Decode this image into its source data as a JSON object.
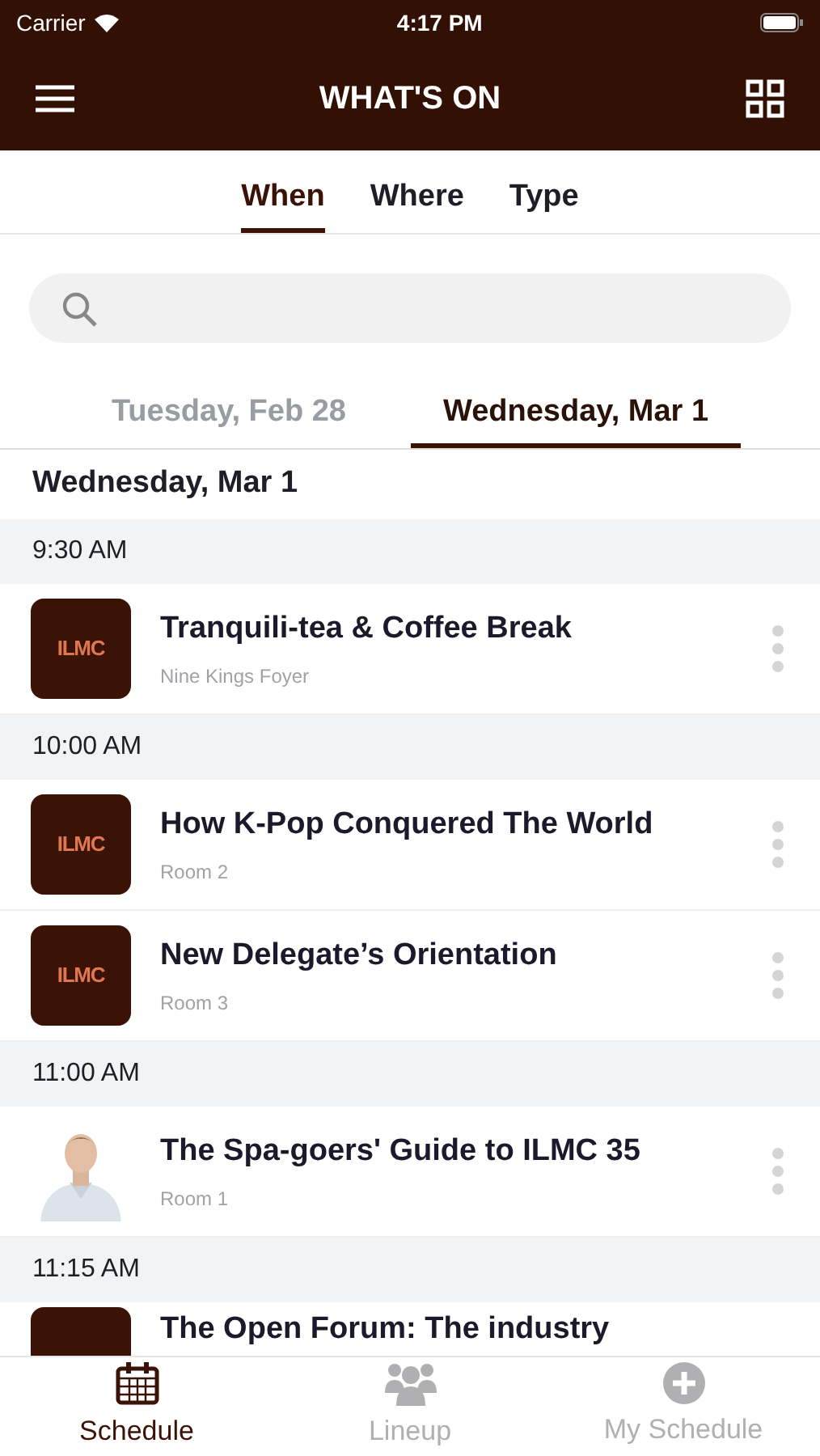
{
  "status_bar": {
    "carrier": "Carrier",
    "time": "4:17 PM"
  },
  "header": {
    "title": "WHAT'S ON"
  },
  "filter_tabs": [
    {
      "label": "When",
      "selected": true
    },
    {
      "label": "Where",
      "selected": false
    },
    {
      "label": "Type",
      "selected": false
    }
  ],
  "date_tabs": [
    {
      "label": "Tuesday, Feb 28",
      "selected": false
    },
    {
      "label": "Wednesday, Mar 1",
      "selected": true
    }
  ],
  "day_heading": "Wednesday, Mar 1",
  "groups": [
    {
      "time": "9:30 AM",
      "sessions": [
        {
          "kind": "logo",
          "logo_text": "ILMC",
          "title": "Tranquili-tea & Coffee Break",
          "room": "Nine Kings Foyer"
        }
      ]
    },
    {
      "time": "10:00 AM",
      "sessions": [
        {
          "kind": "logo",
          "logo_text": "ILMC",
          "title": "How K-Pop Conquered The World",
          "room": "Room 2"
        },
        {
          "kind": "logo",
          "logo_text": "ILMC",
          "title": "New Delegate’s Orientation",
          "room": "Room 3"
        }
      ]
    },
    {
      "time": "11:00 AM",
      "sessions": [
        {
          "kind": "picture",
          "title": "The Spa-goers' Guide to ILMC 35",
          "room": "Room 1"
        }
      ]
    },
    {
      "time": "11:15 AM",
      "sessions": [
        {
          "kind": "logo",
          "title": "The Open Forum: The industry"
        }
      ]
    }
  ],
  "bottom_tabs": [
    {
      "label": "Schedule",
      "kind": "calendar",
      "selected": true
    },
    {
      "label": "Lineup",
      "kind": "people",
      "selected": false
    },
    {
      "label": "My Schedule",
      "kind": "add",
      "selected": false
    }
  ]
}
